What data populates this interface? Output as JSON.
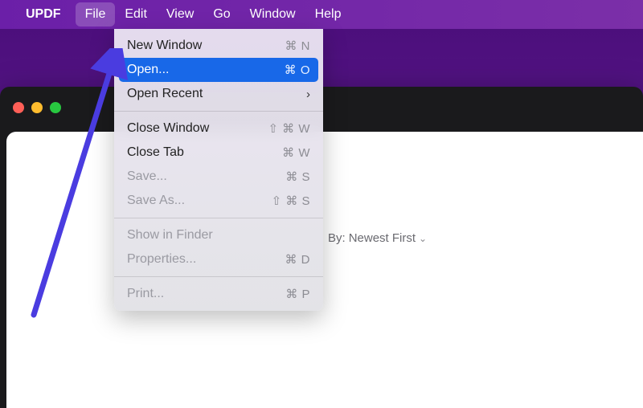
{
  "menubar": {
    "app_name": "UPDF",
    "items": [
      "File",
      "Edit",
      "View",
      "Go",
      "Window",
      "Help"
    ],
    "active": "File"
  },
  "dropdown": {
    "new_window": {
      "label": "New Window",
      "shortcut": "⌘ N"
    },
    "open": {
      "label": "Open...",
      "shortcut": "⌘ O"
    },
    "open_recent": {
      "label": "Open Recent"
    },
    "close_window": {
      "label": "Close Window",
      "shortcut": "⇧ ⌘ W"
    },
    "close_tab": {
      "label": "Close Tab",
      "shortcut": "⌘ W"
    },
    "save": {
      "label": "Save...",
      "shortcut": "⌘ S"
    },
    "save_as": {
      "label": "Save As...",
      "shortcut": "⇧ ⌘ S"
    },
    "show_in_finder": {
      "label": "Show in Finder"
    },
    "properties": {
      "label": "Properties...",
      "shortcut": "⌘ D"
    },
    "print": {
      "label": "Print...",
      "shortcut": "⌘ P"
    }
  },
  "content": {
    "sort_prefix": "By:",
    "sort_value": "Newest First"
  }
}
